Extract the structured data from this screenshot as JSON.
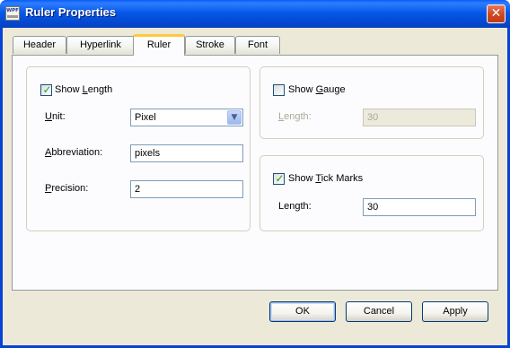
{
  "window": {
    "title": "Ruler Properties",
    "icon_label": "WPF",
    "icon": "app-icon",
    "close_glyph": "✕"
  },
  "tabs": [
    {
      "label": "Header",
      "selected": false
    },
    {
      "label": "Hyperlink",
      "selected": false
    },
    {
      "label": "Ruler",
      "selected": true
    },
    {
      "label": "Stroke",
      "selected": false
    },
    {
      "label": "Font",
      "selected": false
    }
  ],
  "length_group": {
    "show_length": {
      "label_pre": "Show ",
      "label_mn": "L",
      "label_post": "ength",
      "checked": true
    },
    "unit": {
      "label_mn": "U",
      "label_post": "nit:",
      "value": "Pixel"
    },
    "abbreviation": {
      "label_mn": "A",
      "label_post": "bbreviation:",
      "value": "pixels"
    },
    "precision": {
      "label_mn": "P",
      "label_post": "recision:",
      "value": "2"
    }
  },
  "gauge_group": {
    "show_gauge": {
      "label_pre": "Show ",
      "label_mn": "G",
      "label_post": "auge",
      "checked": false
    },
    "length": {
      "label_mn": "L",
      "label_post": "ength:",
      "value": "30",
      "enabled": false
    }
  },
  "tick_group": {
    "show_tick_marks": {
      "label_pre": "Show ",
      "label_mn": "T",
      "label_post": "ick Marks",
      "checked": true
    },
    "length": {
      "label_pre": "Length",
      "label_mn": "",
      "label_post": ":",
      "value": "30",
      "enabled": true
    }
  },
  "buttons": {
    "ok": "OK",
    "cancel": "Cancel",
    "apply": "Apply"
  },
  "glyphs": {
    "check": "✓",
    "dropdown": "▼"
  },
  "colors": {
    "titlebar": "#0a5ef8",
    "dialog_face": "#ece9d8",
    "selected_tab_accent": "#ffc83c",
    "check_mark": "#21a121"
  }
}
